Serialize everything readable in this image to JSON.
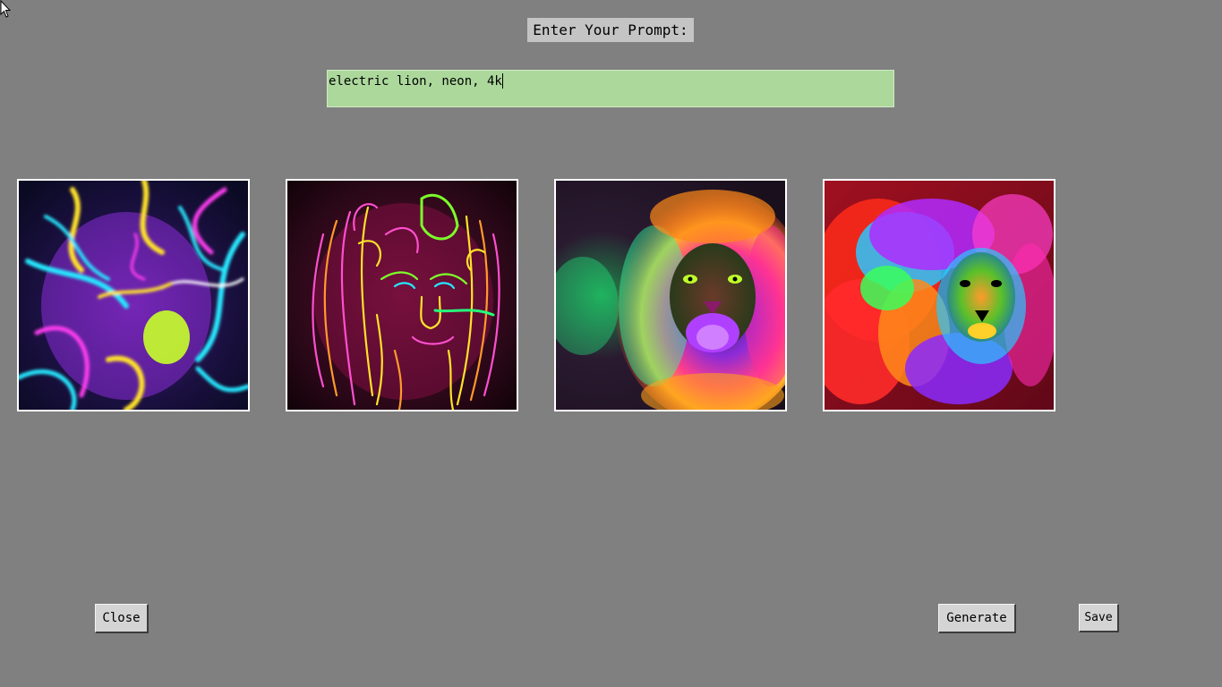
{
  "prompt": {
    "label": "Enter Your Prompt:",
    "value": "electric lion, neon, 4k"
  },
  "images": [
    {
      "name": "neon-lion-image-1",
      "description_icon": "abstract-neon-lion"
    },
    {
      "name": "neon-lion-image-2",
      "description_icon": "line-art-neon-lion"
    },
    {
      "name": "neon-lion-image-3",
      "description_icon": "rainbow-mane-lion"
    },
    {
      "name": "neon-lion-image-4",
      "description_icon": "rainbow-fur-lion"
    }
  ],
  "buttons": {
    "close": "Close",
    "generate": "Generate",
    "save": "Save"
  },
  "colors": {
    "background": "#808080",
    "input_background": "#acd89c",
    "label_background": "#c4c4c4",
    "button_face": "#d4d4d4"
  }
}
